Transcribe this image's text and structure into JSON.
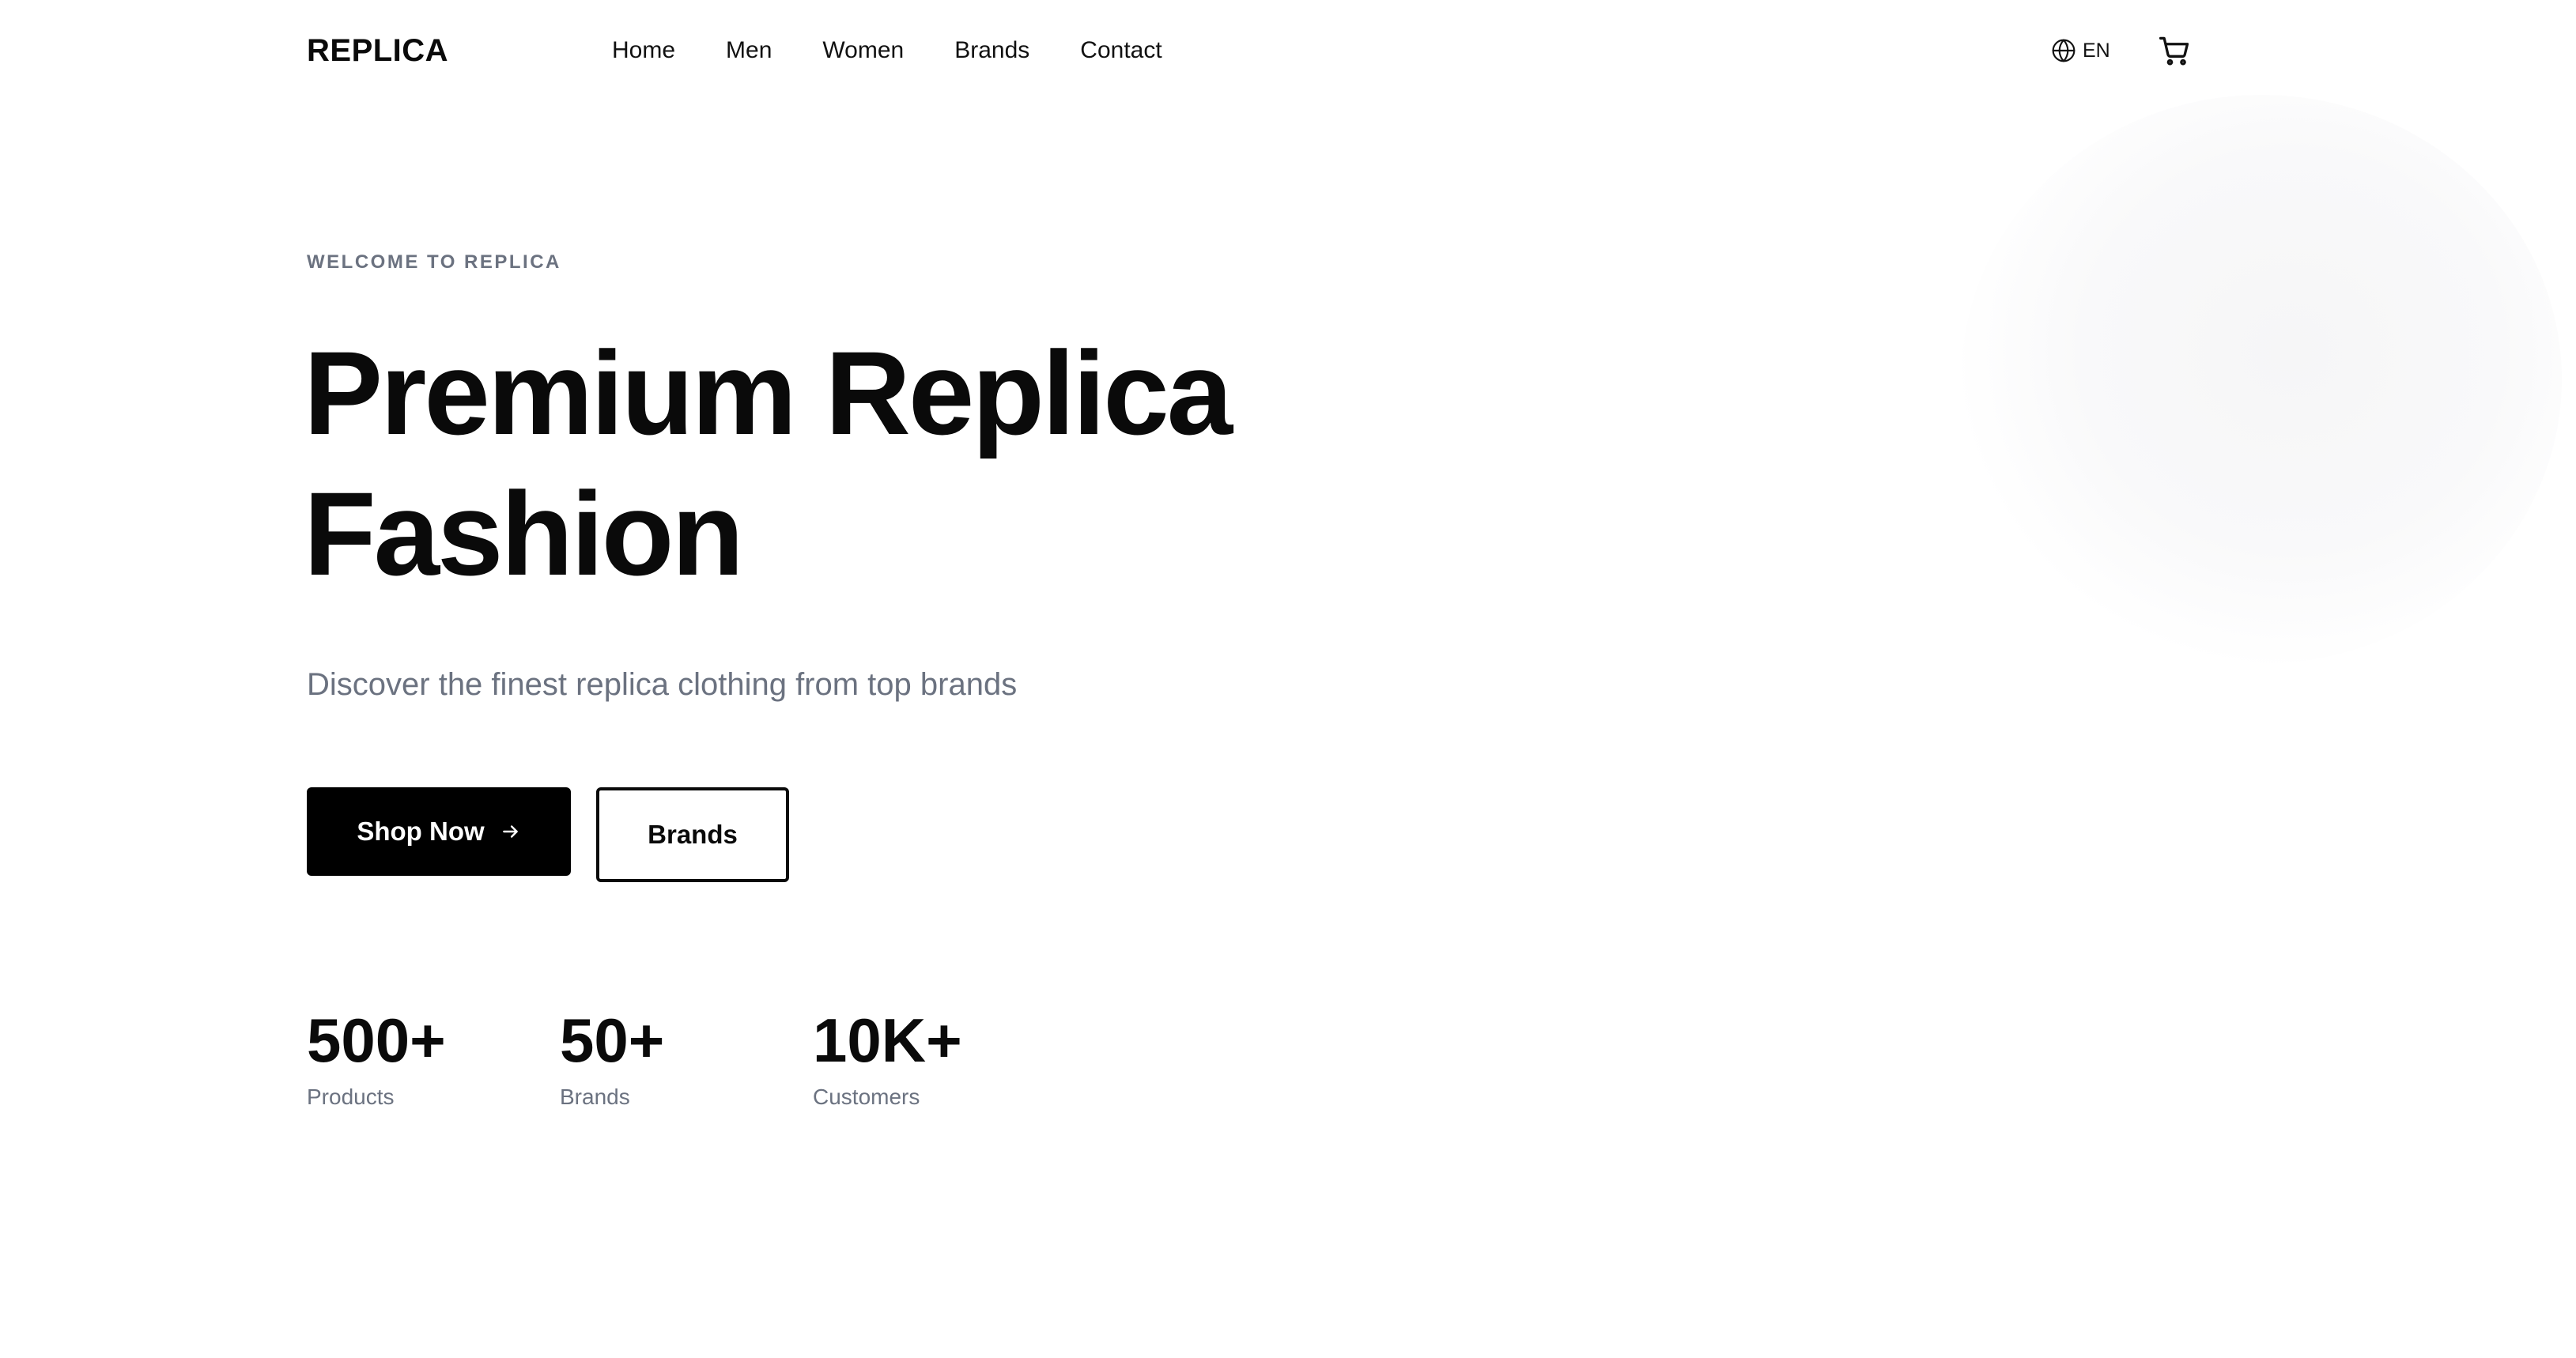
{
  "header": {
    "logo": "REPLICA",
    "nav": [
      "Home",
      "Men",
      "Women",
      "Brands",
      "Contact"
    ],
    "language": "EN"
  },
  "hero": {
    "eyebrow": "WELCOME TO REPLICA",
    "headline_line1": "Premium Replica",
    "headline_line2": "Fashion",
    "subtitle": "Discover the finest replica clothing from top brands",
    "primary_button": "Shop Now",
    "secondary_button": "Brands"
  },
  "stats": [
    {
      "value": "500+",
      "label": "Products"
    },
    {
      "value": "50+",
      "label": "Brands"
    },
    {
      "value": "10K+",
      "label": "Customers"
    }
  ],
  "icons": {
    "language": "globe-icon",
    "cart": "shopping-cart-icon",
    "primary_button": "arrow-right-icon"
  },
  "colors": {
    "text_primary": "#0a0a0a",
    "text_muted": "#6b7280",
    "button_primary_bg": "#000000",
    "button_primary_text": "#ffffff",
    "background": "#ffffff"
  }
}
